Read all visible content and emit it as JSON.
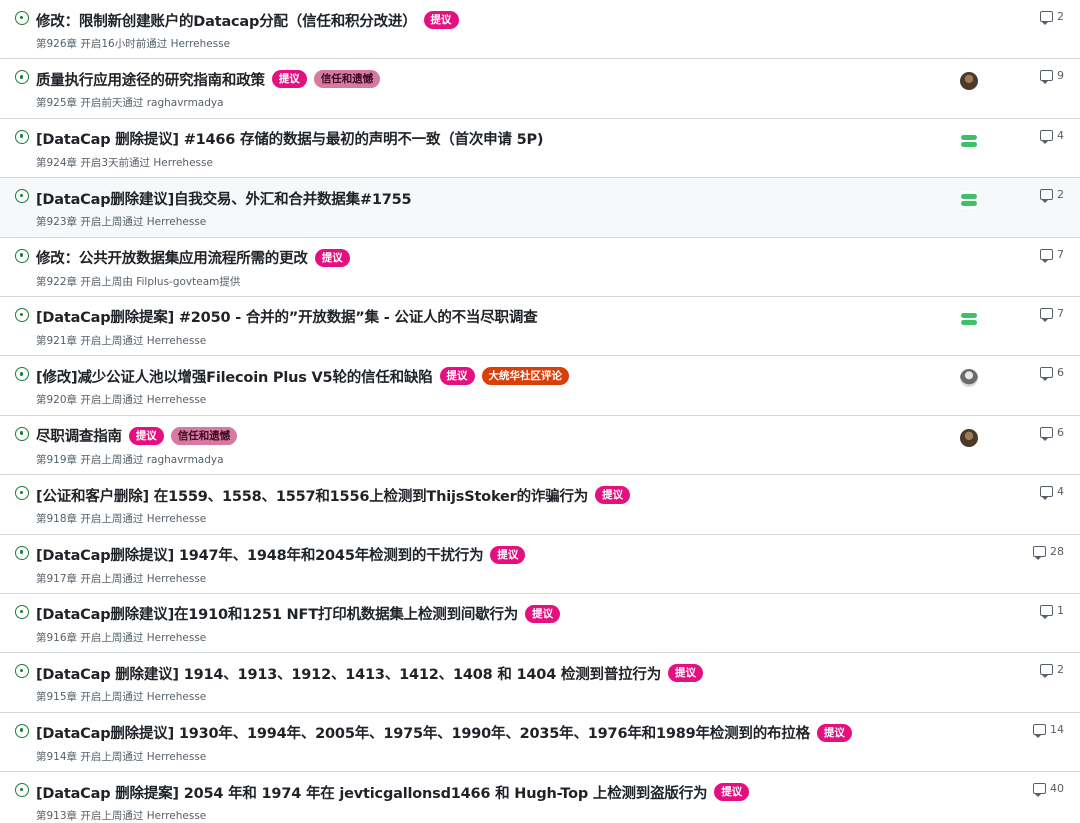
{
  "issues": [
    {
      "title": "修改：限制新创建账户的Datacap分配（信任和积分改进）",
      "labels": [
        {
          "text": "提议",
          "kind": "proposal"
        }
      ],
      "meta": "第926章 开启16小时前通过 Herrehesse",
      "avatar": "",
      "comments": "2"
    },
    {
      "title": "质量执行应用途径的研究指南和政策",
      "labels": [
        {
          "text": "提议",
          "kind": "proposal"
        },
        {
          "text": "信任和遗憾",
          "kind": "trust"
        }
      ],
      "meta": "第925章 开启前天通过 raghavrmadya",
      "avatar": "brown",
      "comments": "9"
    },
    {
      "title": "[DataCap 删除提议] #1466 存储的数据与最初的声明不一致（首次申请 5P)",
      "labels": [],
      "meta": "第924章 开启3天前通过 Herrehesse",
      "avatar": "green",
      "comments": "4"
    },
    {
      "title": "[DataCap删除建议]自我交易、外汇和合并数据集#1755",
      "labels": [],
      "meta": "第923章 开启上周通过 Herrehesse",
      "avatar": "green",
      "comments": "2"
    },
    {
      "title": "修改：公共开放数据集应用流程所需的更改",
      "labels": [
        {
          "text": "提议",
          "kind": "proposal"
        }
      ],
      "meta": "第922章 开启上周由 Filplus-govteam提供",
      "avatar": "",
      "comments": "7"
    },
    {
      "title": "[DataCap删除提案] #2050 - 合并的”开放数据”集 - 公证人的不当尽职调查",
      "labels": [],
      "meta": "第921章 开启上周通过 Herrehesse",
      "avatar": "green",
      "comments": "7"
    },
    {
      "title": "[修改]减少公证人池以增强Filecoin Plus V5轮的信任和缺陷",
      "labels": [
        {
          "text": "提议",
          "kind": "proposal"
        },
        {
          "text": "大统华社区评论",
          "kind": "review"
        }
      ],
      "meta": "第920章 开启上周通过 Herrehesse",
      "avatar": "gray",
      "comments": "6"
    },
    {
      "title": "尽职调查指南",
      "labels": [
        {
          "text": "提议",
          "kind": "proposal"
        },
        {
          "text": "信任和遗憾",
          "kind": "trust"
        }
      ],
      "meta": "第919章 开启上周通过 raghavrmadya",
      "avatar": "brown",
      "comments": "6"
    },
    {
      "title": "[公证和客户删除] 在1559、1558、1557和1556上检测到ThijsStoker的诈骗行为",
      "labels": [
        {
          "text": "提议",
          "kind": "proposal"
        }
      ],
      "meta": "第918章 开启上周通过 Herrehesse",
      "avatar": "",
      "comments": "4"
    },
    {
      "title": "[DataCap删除提议] 1947年、1948年和2045年检测到的干扰行为",
      "labels": [
        {
          "text": "提议",
          "kind": "proposal"
        }
      ],
      "meta": "第917章 开启上周通过 Herrehesse",
      "avatar": "",
      "comments": "28"
    },
    {
      "title": "[DataCap删除建议]在1910和1251 NFT打印机数据集上检测到间歇行为",
      "labels": [
        {
          "text": "提议",
          "kind": "proposal"
        }
      ],
      "meta": "第916章 开启上周通过 Herrehesse",
      "avatar": "",
      "comments": "1"
    },
    {
      "title": "[DataCap 删除建议] 1914、1913、1912、1413、1412、1408 和 1404 检测到普拉行为",
      "labels": [
        {
          "text": "提议",
          "kind": "proposal"
        }
      ],
      "meta": "第915章 开启上周通过 Herrehesse",
      "avatar": "",
      "comments": "2"
    },
    {
      "title": "[DataCap删除提议] 1930年、1994年、2005年、1975年、1990年、2035年、1976年和1989年检测到的布拉格",
      "labels": [
        {
          "text": "提议",
          "kind": "proposal"
        }
      ],
      "meta": "第914章 开启上周通过 Herrehesse",
      "avatar": "",
      "comments": "14"
    },
    {
      "title": "[DataCap 删除提案] 2054 年和 1974 年在 jevticgallonsd1466 和 Hugh-Top 上检测到盗版行为",
      "labels": [
        {
          "text": "提议",
          "kind": "proposal"
        }
      ],
      "meta": "第913章 开启上周通过 Herrehesse",
      "avatar": "",
      "comments": "40"
    }
  ],
  "colors": {
    "open_icon": "#1a7f37",
    "proposal_label": "#e4107f",
    "trust_label": "#d67aa3",
    "review_label": "#d93f0b"
  },
  "icons": {
    "status": "issue-opened-icon",
    "comments": "comment-icon"
  }
}
